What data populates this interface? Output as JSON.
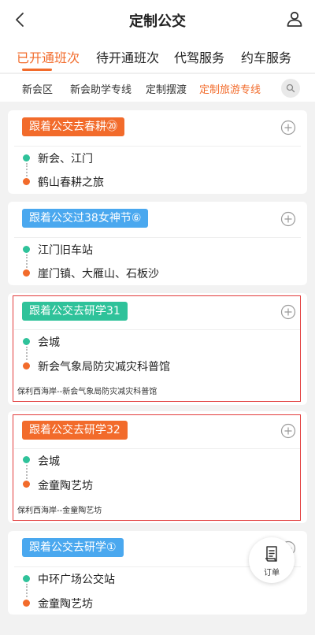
{
  "header": {
    "title": "定制公交",
    "back_icon": "chevron-left-icon",
    "user_icon": "user-icon"
  },
  "tabs": [
    {
      "label": "已开通班次",
      "active": true
    },
    {
      "label": "待开通班次",
      "active": false
    },
    {
      "label": "代驾服务",
      "active": false
    },
    {
      "label": "约车服务",
      "active": false
    }
  ],
  "subtabs": [
    {
      "label": "新会区",
      "active": false
    },
    {
      "label": "新会助学专线",
      "active": false
    },
    {
      "label": "定制摆渡",
      "active": false
    },
    {
      "label": "定制旅游专线",
      "active": true
    }
  ],
  "cards": [
    {
      "tag": "跟着公交去春耕⑳",
      "tag_color": "#f26b2b",
      "from": "新会、江门",
      "to": "鹤山春耕之旅",
      "route": ""
    },
    {
      "tag": "跟着公交过38女神节⑥",
      "tag_color": "#4aa8ef",
      "from": "江门旧车站",
      "to": "崖门镇、大雁山、石板沙",
      "route": ""
    },
    {
      "tag": "跟着公交去研学31",
      "tag_color": "#2fc29a",
      "from": "会城",
      "to": "新会气象局防灾减灾科普馆",
      "route": "保利西海岸--新会气象局防灾减灾科普馆"
    },
    {
      "tag": "跟着公交去研学32",
      "tag_color": "#f26b2b",
      "from": "会城",
      "to": "金童陶艺坊",
      "route": "保利西海岸--金童陶艺坊"
    },
    {
      "tag": "跟着公交去研学①",
      "tag_color": "#4aa8ef",
      "from": "中环广场公交站",
      "to": "金童陶艺坊",
      "route": ""
    }
  ],
  "floating": {
    "order_label": "订单"
  },
  "colors": {
    "accent": "#f26b2b",
    "green": "#2fc29a",
    "blue": "#4aa8ef",
    "highlight": "#e23b3b"
  }
}
